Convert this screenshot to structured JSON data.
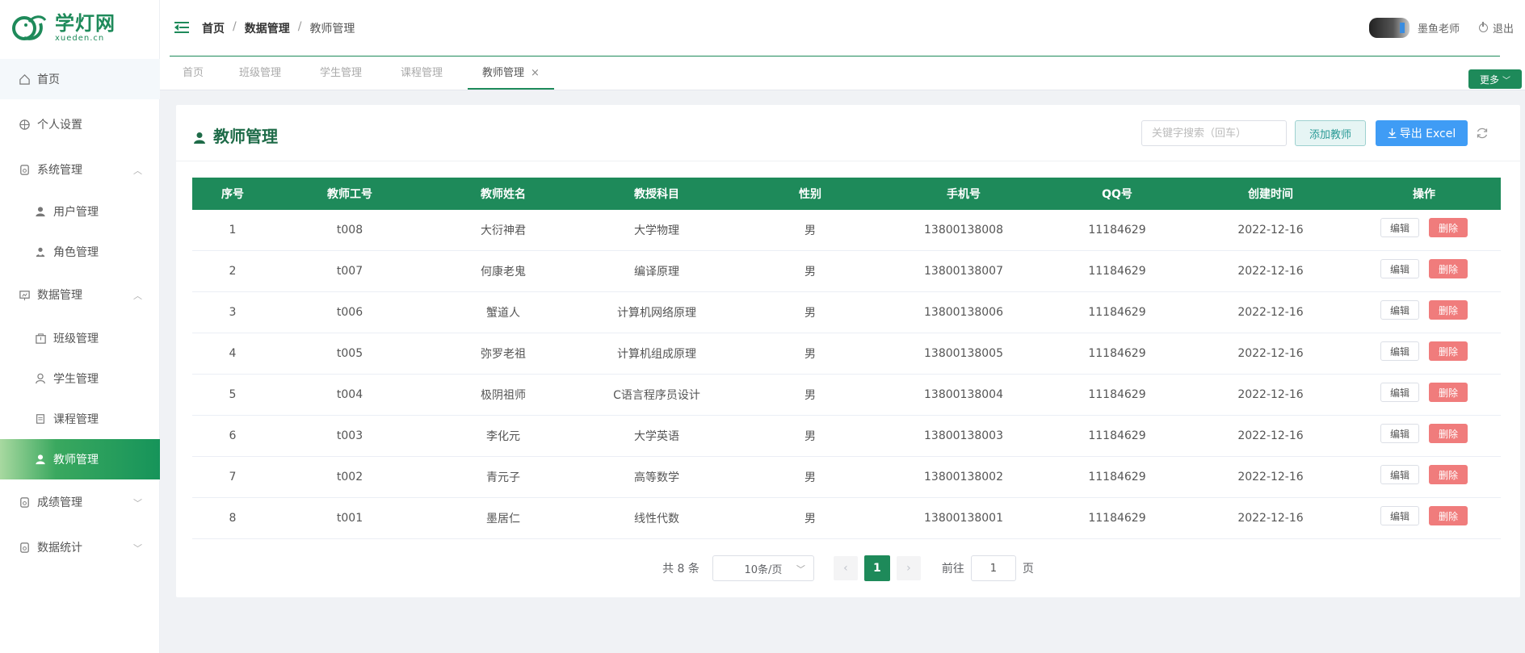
{
  "brand": {
    "logo_cn": "学灯网",
    "logo_en": "xueden.cn",
    "color": "#1e8a5a"
  },
  "sidebar": {
    "items": [
      {
        "label": "首页",
        "icon": "home-icon"
      },
      {
        "label": "个人设置",
        "icon": "settings-icon"
      },
      {
        "label": "系统管理",
        "icon": "medal-icon",
        "expanded": true
      },
      {
        "label": "用户管理",
        "icon": "user-icon"
      },
      {
        "label": "角色管理",
        "icon": "role-icon"
      },
      {
        "label": "数据管理",
        "icon": "chart-icon",
        "expanded": true
      },
      {
        "label": "班级管理",
        "icon": "class-icon"
      },
      {
        "label": "学生管理",
        "icon": "student-icon"
      },
      {
        "label": "课程管理",
        "icon": "course-icon"
      },
      {
        "label": "教师管理",
        "icon": "teacher-icon",
        "active": true
      },
      {
        "label": "成绩管理",
        "icon": "medal-icon",
        "expanded": false
      },
      {
        "label": "数据统计",
        "icon": "medal-icon",
        "expanded": false
      }
    ]
  },
  "header": {
    "breadcrumb": [
      "首页",
      "数据管理",
      "教师管理"
    ],
    "separator": "/",
    "username": "墨鱼老师",
    "logout": "退出"
  },
  "tabs": {
    "items": [
      "首页",
      "班级管理",
      "学生管理",
      "课程管理",
      "教师管理"
    ],
    "active": "教师管理",
    "close_glyph": "×",
    "more": "更多"
  },
  "card": {
    "title": "教师管理",
    "search_placeholder": "关键字搜索（回车）",
    "add_button": "添加教师",
    "export_button": "导出 Excel"
  },
  "table": {
    "columns": [
      "序号",
      "教师工号",
      "教师姓名",
      "教授科目",
      "性别",
      "手机号",
      "QQ号",
      "创建时间",
      "操作"
    ],
    "edit_label": "编辑",
    "delete_label": "删除",
    "rows": [
      [
        "1",
        "t008",
        "大衍神君",
        "大学物理",
        "男",
        "13800138008",
        "11184629",
        "2022-12-16"
      ],
      [
        "2",
        "t007",
        "何康老鬼",
        "编译原理",
        "男",
        "13800138007",
        "11184629",
        "2022-12-16"
      ],
      [
        "3",
        "t006",
        "蟹道人",
        "计算机网络原理",
        "男",
        "13800138006",
        "11184629",
        "2022-12-16"
      ],
      [
        "4",
        "t005",
        "弥罗老祖",
        "计算机组成原理",
        "男",
        "13800138005",
        "11184629",
        "2022-12-16"
      ],
      [
        "5",
        "t004",
        "极阴祖师",
        "C语言程序员设计",
        "男",
        "13800138004",
        "11184629",
        "2022-12-16"
      ],
      [
        "6",
        "t003",
        "李化元",
        "大学英语",
        "男",
        "13800138003",
        "11184629",
        "2022-12-16"
      ],
      [
        "7",
        "t002",
        "青元子",
        "高等数学",
        "男",
        "13800138002",
        "11184629",
        "2022-12-16"
      ],
      [
        "8",
        "t001",
        "墨居仁",
        "线性代数",
        "男",
        "13800138001",
        "11184629",
        "2022-12-16"
      ]
    ]
  },
  "pagination": {
    "total_text": "共 8 条",
    "page_size": "10条/页",
    "current_page": "1",
    "goto_prefix": "前往",
    "goto_value": "1",
    "goto_suffix": "页"
  }
}
